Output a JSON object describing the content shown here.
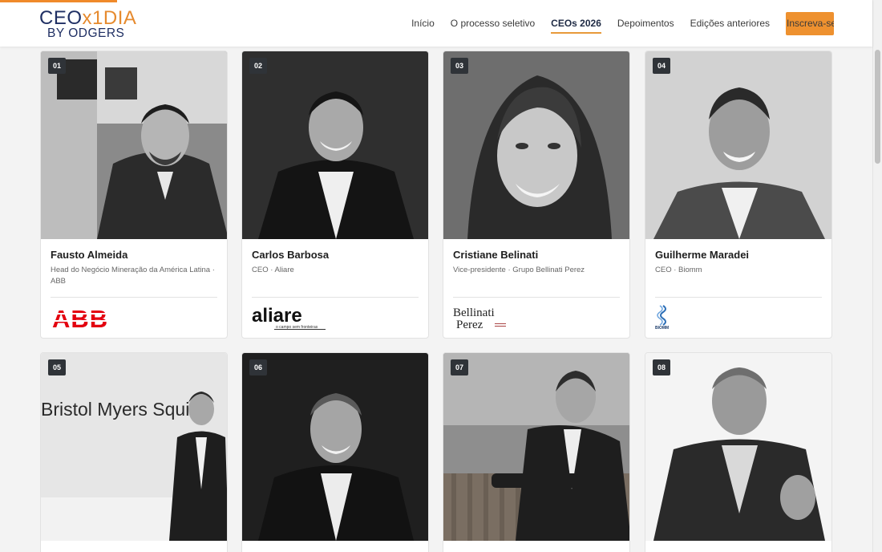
{
  "header": {
    "logo": {
      "brand_main": "CEO",
      "brand_accent": "x1DIA",
      "brand_sub": "BY ODGERS"
    },
    "nav": [
      {
        "label": "Início"
      },
      {
        "label": "O processo seletivo"
      },
      {
        "label": "CEOs 2026",
        "active": true
      },
      {
        "label": "Depoimentos"
      },
      {
        "label": "Edições anteriores"
      }
    ],
    "cta_label": "Inscreva-se"
  },
  "colors": {
    "accent": "#ee912f",
    "brand_navy": "#1f2f63",
    "badge": "#2f3338"
  },
  "ceos": [
    {
      "number": "01",
      "name": "Fausto Almeida",
      "role": "Head do Negócio Mineração da América Latina · ABB",
      "company_logo": "abb-logo",
      "logo_text": "ABB"
    },
    {
      "number": "02",
      "name": "Carlos Barbosa",
      "role": "CEO · Aliare",
      "company_logo": "aliare-logo",
      "logo_text": "aliare",
      "logo_tagline": "o campo sem fronteiras"
    },
    {
      "number": "03",
      "name": "Cristiane Belinati",
      "role": "Vice-presidente · Grupo Bellinati Perez",
      "company_logo": "bellinati-perez-logo",
      "logo_text": "Bellinati",
      "logo_text_2": "Perez"
    },
    {
      "number": "04",
      "name": "Guilherme Maradei",
      "role": "CEO · Biomm",
      "company_logo": "biomm-logo",
      "logo_text": "BIOMM"
    },
    {
      "number": "05",
      "background_text": "Bristol Myers Squibb"
    },
    {
      "number": "06"
    },
    {
      "number": "07"
    },
    {
      "number": "08"
    }
  ]
}
